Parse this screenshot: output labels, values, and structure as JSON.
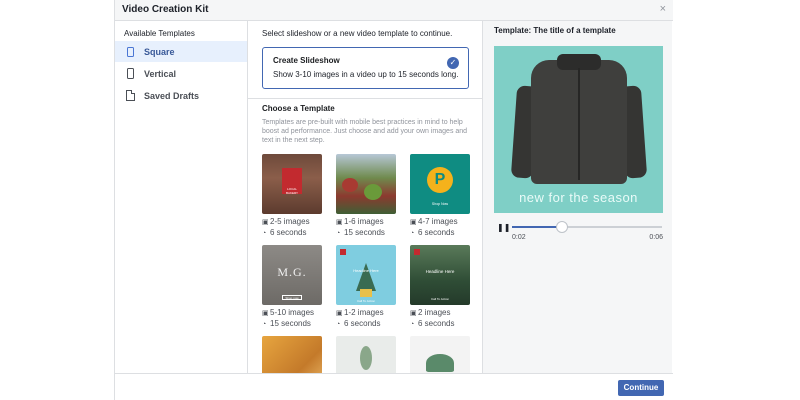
{
  "dialog": {
    "title": "Video Creation Kit",
    "close_icon": "×"
  },
  "sidebar": {
    "heading": "Available Templates",
    "items": [
      {
        "label": "Square",
        "icon": "square-format-icon",
        "active": true
      },
      {
        "label": "Vertical",
        "icon": "vertical-format-icon",
        "active": false
      },
      {
        "label": "Saved Drafts",
        "icon": "document-icon",
        "active": false
      }
    ]
  },
  "main": {
    "intro": "Select slideshow or a new video template to continue.",
    "slideshow": {
      "title": "Create Slideshow",
      "description": "Show 3-10 images in a video up to 15 seconds long.",
      "check": "✓",
      "selected": true
    },
    "choose_title": "Choose a Template",
    "choose_description": "Templates are pre-built with mobile best practices in mind to help boost ad performance. Just choose and add your own images and text in the next step.",
    "thumb_texts": {
      "t1": "LOCAL BAKERY",
      "t3_letter": "P",
      "t3_cta": "Shop Now",
      "t4_title": "M.G.",
      "t4_cta": "Shop now",
      "t5_head": "Headline Here",
      "t5_cta": "Call To Action",
      "t6_head": "Headline Here",
      "t6_cta": "Call To Action"
    },
    "templates": [
      {
        "images": "2-5 images",
        "duration": "6 seconds"
      },
      {
        "images": "1-6 images",
        "duration": "15 seconds"
      },
      {
        "images": "4-7 images",
        "duration": "6 seconds"
      },
      {
        "images": "5-10 images",
        "duration": "15 seconds"
      },
      {
        "images": "1-2 images",
        "duration": "6 seconds"
      },
      {
        "images": "2 images",
        "duration": "6 seconds"
      }
    ],
    "meta_icons": {
      "images": "▣",
      "duration": "◔"
    }
  },
  "preview": {
    "title": "Template: The title of a template",
    "caption": "new for the season",
    "pause_icon": "❚❚",
    "current_time": "0:02",
    "duration": "0:06",
    "progress": 0.33
  },
  "footer": {
    "continue_label": "Continue"
  },
  "colors": {
    "accent": "#4267b2",
    "preview_bg": "#7fcfc6"
  }
}
